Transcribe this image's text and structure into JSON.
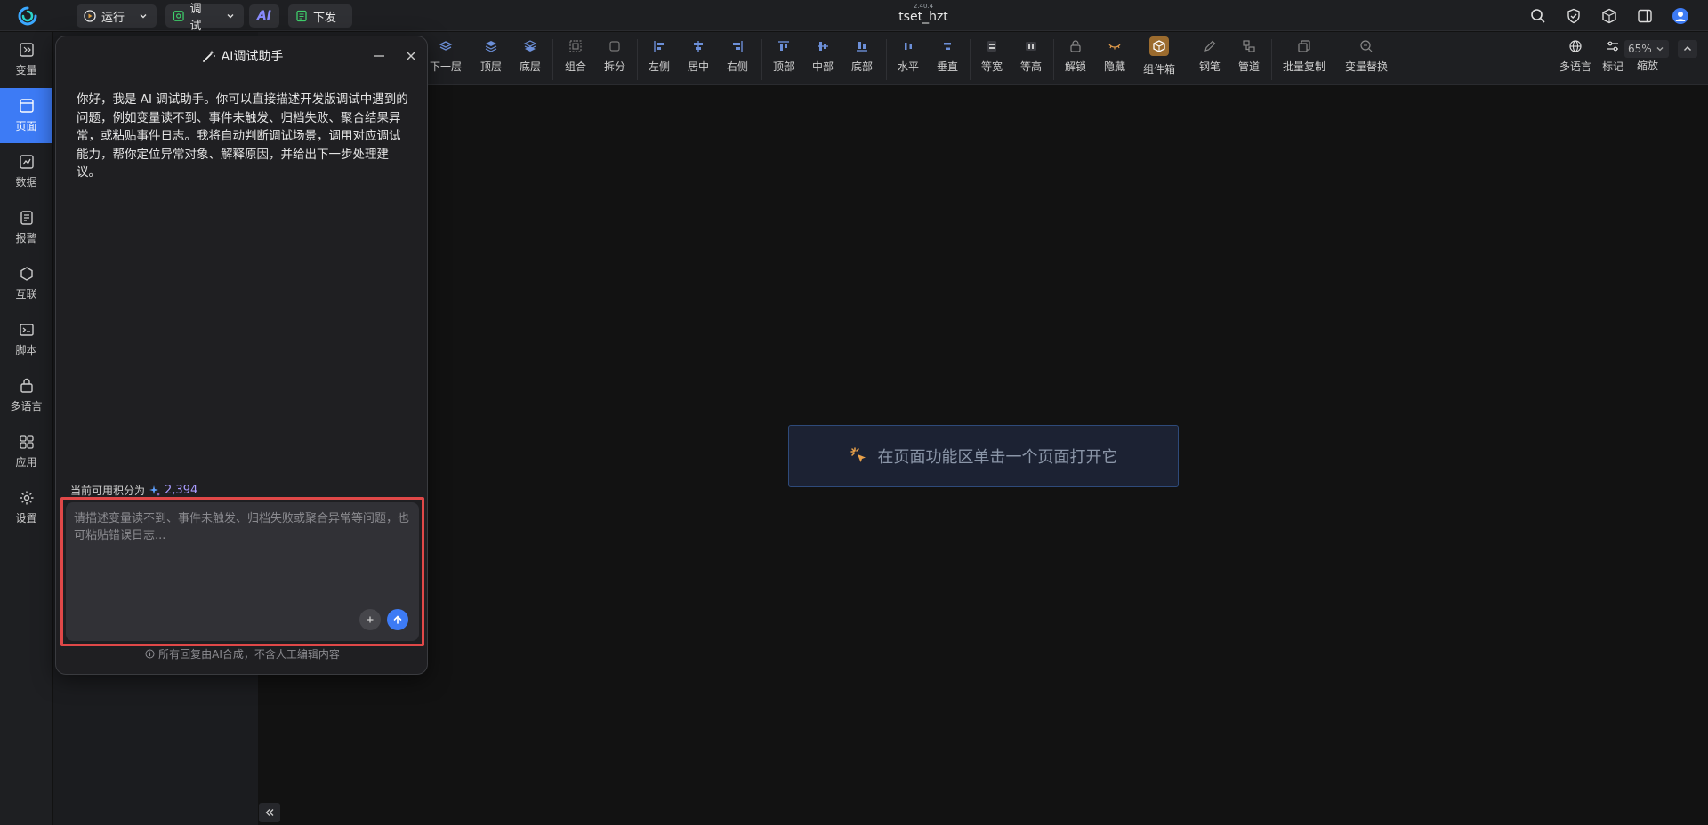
{
  "titlebar": {
    "run_label": "运行",
    "debug_label": "调试",
    "ai_label": "AI",
    "deploy_label": "下发",
    "version": "2.40.4",
    "app_name": "tset_hzt"
  },
  "leftnav": {
    "items": [
      {
        "label": "变量",
        "icon": "variable-icon"
      },
      {
        "label": "页面",
        "icon": "page-icon",
        "active": true
      },
      {
        "label": "数据",
        "icon": "data-icon"
      },
      {
        "label": "报警",
        "icon": "alarm-icon"
      },
      {
        "label": "互联",
        "icon": "connect-icon"
      },
      {
        "label": "脚本",
        "icon": "script-icon"
      },
      {
        "label": "多语言",
        "icon": "language-icon"
      },
      {
        "label": "应用",
        "icon": "apps-icon"
      },
      {
        "label": "设置",
        "icon": "settings-icon"
      }
    ]
  },
  "toolbar": {
    "items": [
      {
        "label": "下一层"
      },
      {
        "label": "顶层"
      },
      {
        "label": "底层"
      },
      {
        "label": "组合"
      },
      {
        "label": "拆分"
      },
      {
        "label": "左侧"
      },
      {
        "label": "居中"
      },
      {
        "label": "右侧"
      },
      {
        "label": "顶部"
      },
      {
        "label": "中部"
      },
      {
        "label": "底部"
      },
      {
        "label": "水平"
      },
      {
        "label": "垂直"
      },
      {
        "label": "等宽"
      },
      {
        "label": "等高"
      },
      {
        "label": "解锁"
      },
      {
        "label": "隐藏"
      },
      {
        "label": "组件箱"
      },
      {
        "label": "钢笔"
      },
      {
        "label": "管道"
      },
      {
        "label": "批量复制"
      },
      {
        "label": "变量替换"
      },
      {
        "label": "多语言"
      },
      {
        "label": "标记"
      },
      {
        "label": "缩放"
      }
    ],
    "zoom": "65%"
  },
  "canvas": {
    "hint": "在页面功能区单击一个页面打开它"
  },
  "ai_panel": {
    "title": "AI调试助手",
    "intro": "你好，我是 AI 调试助手。你可以直接描述开发版调试中遇到的问题，例如变量读不到、事件未触发、归档失败、聚合结果异常，或粘贴事件日志。我将自动判断调试场景，调用对应调试能力，帮你定位异常对象、解释原因，并给出下一步处理建议。",
    "credits_label": "当前可用积分为",
    "credits_value": "2,394",
    "input_placeholder": "请描述变量读不到、事件未触发、归档失败或聚合异常等问题，也可粘贴错误日志...",
    "footer": "所有回复由AI合成，不含人工编辑内容"
  },
  "colors": {
    "accent": "#3d7bf5",
    "highlight_border": "#e04848",
    "hint_border": "#2e4a7a"
  }
}
